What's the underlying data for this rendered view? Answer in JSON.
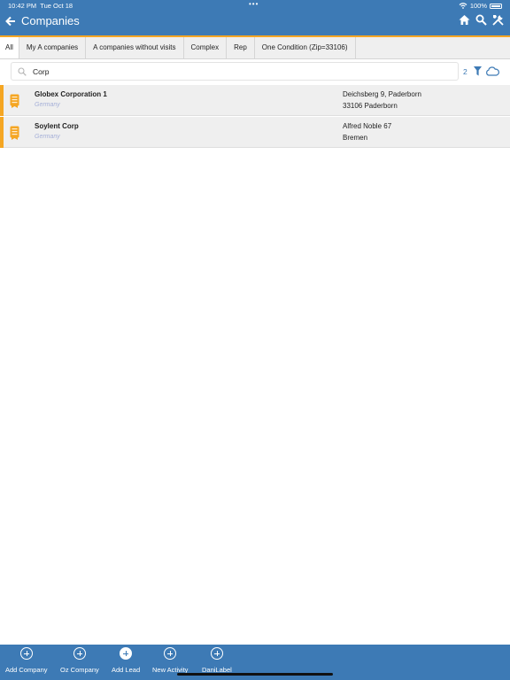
{
  "status_bar": {
    "time": "10:42 PM",
    "date": "Tue Oct 18",
    "dots": "•••",
    "battery": "100%"
  },
  "header": {
    "title": "Companies",
    "icons": [
      "back-arrow-icon",
      "home-icon",
      "search-icon",
      "tools-icon"
    ]
  },
  "tabs": [
    {
      "label": "All",
      "active": true
    },
    {
      "label": "My A companies"
    },
    {
      "label": "A companies without visits"
    },
    {
      "label": "Complex"
    },
    {
      "label": "Rep"
    },
    {
      "label": "One Condition (Zip=33106)"
    }
  ],
  "search": {
    "value": "Corp",
    "result_count": "2"
  },
  "companies": [
    {
      "name": "Globex Corporation 1",
      "country": "Germany",
      "address_line1": "Deichsberg 9, Paderborn",
      "address_line2": "33106 Paderborn"
    },
    {
      "name": "Soylent Corp",
      "country": "Germany",
      "address_line1": "Alfred Noble 67",
      "address_line2": "Bremen"
    }
  ],
  "toolbar": [
    {
      "label": "Add Company"
    },
    {
      "label": "Oz Company"
    },
    {
      "label": "Add Lead"
    },
    {
      "label": "New Activity"
    },
    {
      "label": "DaniLabel"
    }
  ],
  "colors": {
    "header": "#3d7ab5",
    "accent": "#f5a623",
    "row_background": "#efefef"
  }
}
